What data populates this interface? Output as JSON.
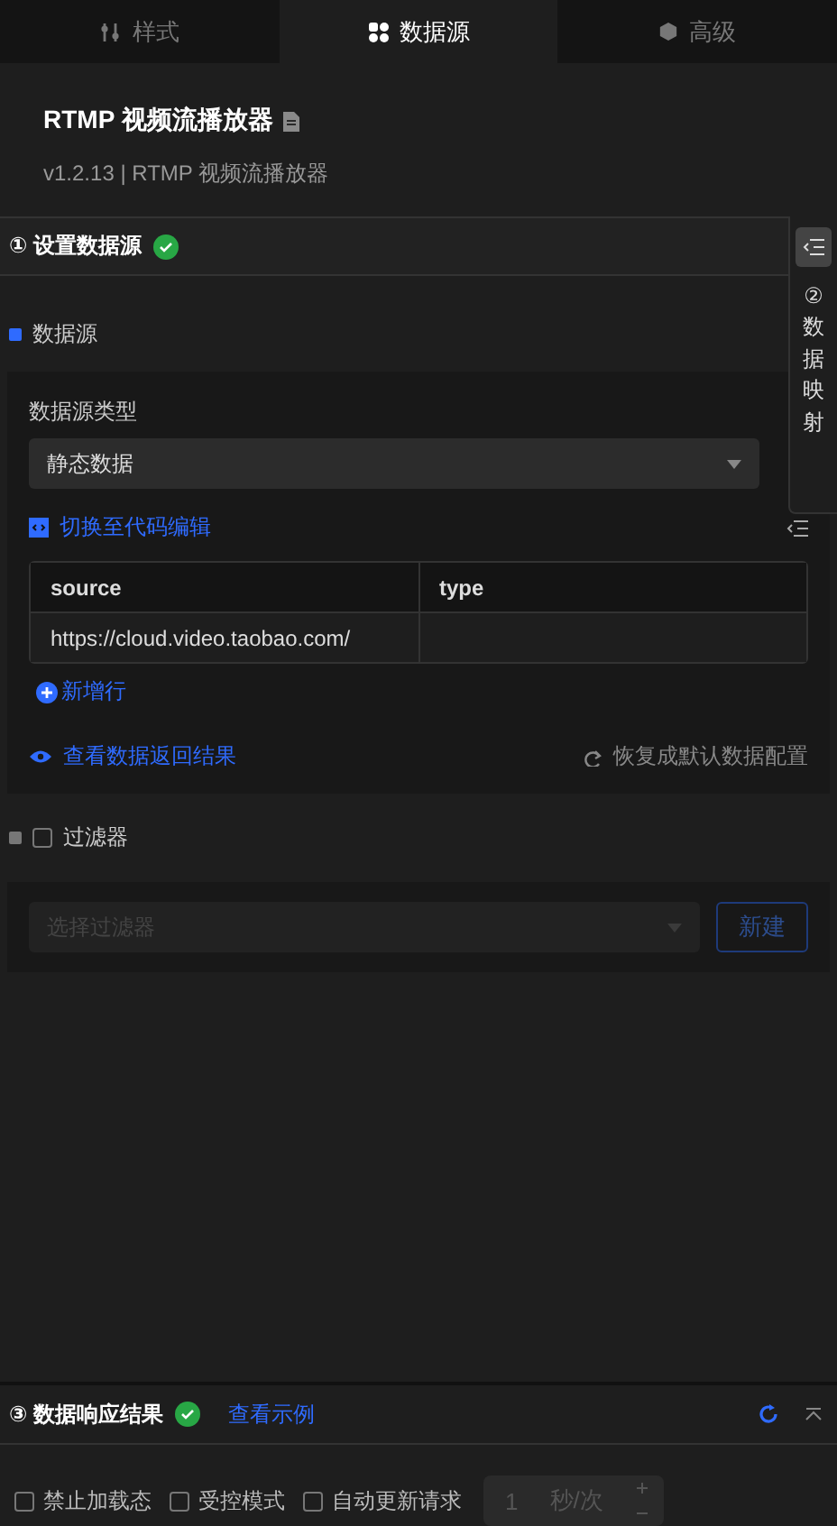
{
  "tabs": [
    {
      "label": "样式",
      "selected": false
    },
    {
      "label": "数据源",
      "selected": true
    },
    {
      "label": "高级",
      "selected": false
    }
  ],
  "component": {
    "title": "RTMP 视频流播放器",
    "subtitle": "v1.2.13 | RTMP 视频流播放器"
  },
  "step1": {
    "title": "① 设置数据源",
    "done": true
  },
  "side_panel": {
    "number": "②",
    "label": "数据映射"
  },
  "datasource": {
    "heading": "数据源",
    "type_label": "数据源类型",
    "type_value": "静态数据",
    "code_link": "切换至代码编辑",
    "table": {
      "columns": [
        "source",
        "type"
      ],
      "rows": [
        [
          "https://cloud.video.taobao.com/",
          ""
        ]
      ]
    },
    "add_row": "新增行",
    "view_result": "查看数据返回结果",
    "reset": "恢复成默认数据配置"
  },
  "filter": {
    "label": "过滤器",
    "checked": false,
    "placeholder": "选择过滤器",
    "new_button": "新建"
  },
  "step3": {
    "title": "③ 数据响应结果",
    "done": true,
    "example_link": "查看示例"
  },
  "options": [
    {
      "label": "禁止加载态",
      "checked": false
    },
    {
      "label": "受控模式",
      "checked": false
    },
    {
      "label": "自动更新请求",
      "checked": false
    }
  ],
  "interval": {
    "value": "1",
    "unit": "秒/次"
  }
}
